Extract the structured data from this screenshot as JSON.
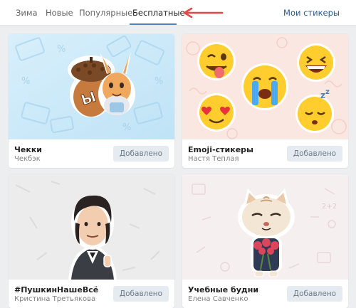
{
  "tabs": [
    {
      "label": "Зима"
    },
    {
      "label": "Новые"
    },
    {
      "label": "Популярные"
    },
    {
      "label": "Бесплатные"
    }
  ],
  "my_stickers_label": "Мои стикеры",
  "accent": "#5181b8",
  "arrow_color": "#e64646",
  "cards": [
    {
      "title": "Чекки",
      "author": "Чекбэк",
      "button": "Добавлено"
    },
    {
      "title": "Emoji-стикеры",
      "author": "Настя Теплая",
      "button": "Добавлено"
    },
    {
      "title": "#ПушкинНашеВсё",
      "author": "Кристина Третьякова",
      "button": "Добавлено"
    },
    {
      "title": "Учебные будни",
      "author": "Елена Савченко",
      "button": "Добавлено"
    }
  ]
}
